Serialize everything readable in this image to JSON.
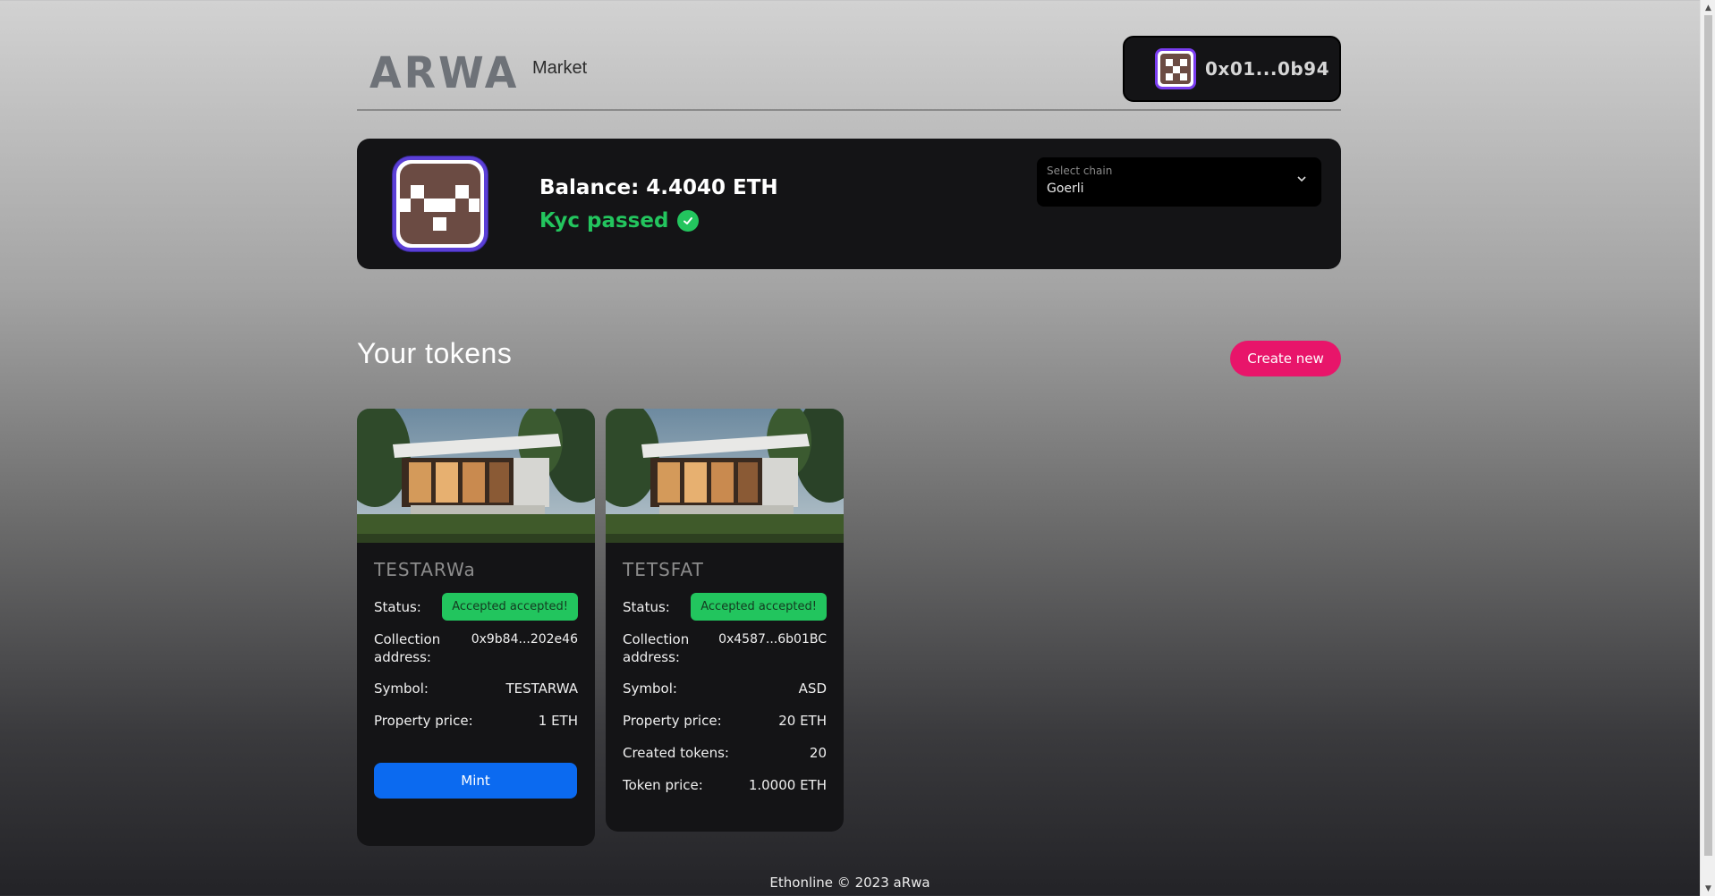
{
  "header": {
    "logo_text": "ARWA",
    "nav_market": "Market",
    "wallet_address": "0x01...0b94"
  },
  "profile": {
    "balance": "Balance: 4.4040 ETH",
    "kyc_status": "Kyc passed",
    "chain_select": {
      "label": "Select chain",
      "value": "Goerli"
    }
  },
  "tokens_section": {
    "title": "Your tokens",
    "create_button": "Create new"
  },
  "tokens": [
    {
      "name": "TESTARWa",
      "status_label": "Status:",
      "status": "Accepted accepted!",
      "collection_label": "Collection address:",
      "collection_address": "0x9b84...202e46",
      "symbol_label": "Symbol:",
      "symbol": "TESTARWA",
      "price_label": "Property price:",
      "price": "1 ETH",
      "mint_button": "Mint"
    },
    {
      "name": "TETSFAT",
      "status_label": "Status:",
      "status": "Accepted accepted!",
      "collection_label": "Collection address:",
      "collection_address": "0x4587...6b01BC",
      "symbol_label": "Symbol:",
      "symbol": "ASD",
      "price_label": "Property price:",
      "price": "20 ETH",
      "created_label": "Created tokens:",
      "created_tokens": "20",
      "token_price_label": "Token price:",
      "token_price": "1.0000 ETH"
    }
  ],
  "footer": {
    "text": "Ethonline © 2023 aRwa"
  },
  "colors": {
    "accent_pink": "#e8156a",
    "success_green": "#22c55e",
    "mint_blue": "#0b6af0",
    "card_bg": "#141416"
  },
  "icons": [
    "chevron-down-icon",
    "check-circle-icon",
    "pixel-avatar-icon"
  ]
}
